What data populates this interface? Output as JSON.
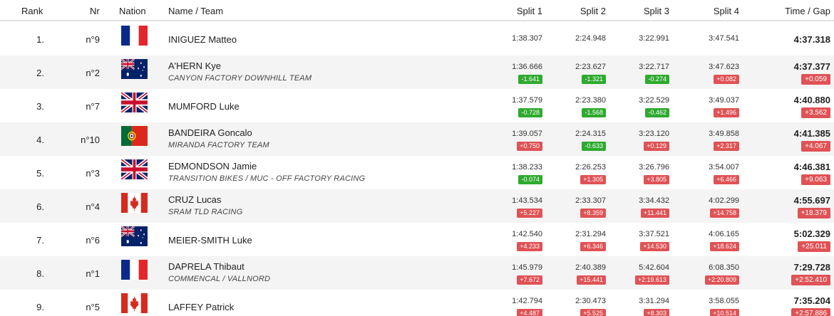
{
  "header": {
    "rank": "Rank",
    "nr": "Nr",
    "nation": "Nation",
    "name_team": "Name / Team",
    "split1": "Split 1",
    "split2": "Split 2",
    "split3": "Split 3",
    "split4": "Split 4",
    "time_gap": "Time / Gap"
  },
  "colors": {
    "positive_gap": "#e05255",
    "negative_gap": "#2eaa2e",
    "row_stripe": "#f4f4f4"
  },
  "rows": [
    {
      "rank": "1.",
      "nr": "n°9",
      "nation": "france-flag",
      "name": "INIGUEZ Matteo",
      "team": "",
      "splits": [
        {
          "time": "1:38.307",
          "diff": "",
          "sign": ""
        },
        {
          "time": "2:24.948",
          "diff": "",
          "sign": ""
        },
        {
          "time": "3:22.991",
          "diff": "",
          "sign": ""
        },
        {
          "time": "3:47.541",
          "diff": "",
          "sign": ""
        }
      ],
      "time": "4:37.318",
      "gap": ""
    },
    {
      "rank": "2.",
      "nr": "n°2",
      "nation": "australia-flag",
      "name": "A'HERN Kye",
      "team": "CANYON FACTORY DOWNHILL TEAM",
      "splits": [
        {
          "time": "1:36.666",
          "diff": "-1.641",
          "sign": "neg"
        },
        {
          "time": "2:23.627",
          "diff": "-1.321",
          "sign": "neg"
        },
        {
          "time": "3:22.717",
          "diff": "-0.274",
          "sign": "neg"
        },
        {
          "time": "3:47.623",
          "diff": "+0.082",
          "sign": "pos"
        }
      ],
      "time": "4:37.377",
      "gap": "+0.059"
    },
    {
      "rank": "3.",
      "nr": "n°7",
      "nation": "uk-flag",
      "name": "MUMFORD Luke",
      "team": "",
      "splits": [
        {
          "time": "1:37.579",
          "diff": "-0.728",
          "sign": "neg"
        },
        {
          "time": "2:23.380",
          "diff": "-1.568",
          "sign": "neg"
        },
        {
          "time": "3:22.529",
          "diff": "-0.462",
          "sign": "neg"
        },
        {
          "time": "3:49.037",
          "diff": "+1.496",
          "sign": "pos"
        }
      ],
      "time": "4:40.880",
      "gap": "+3.562"
    },
    {
      "rank": "4.",
      "nr": "n°10",
      "nation": "portugal-flag",
      "name": "BANDEIRA Goncalo",
      "team": "MIRANDA FACTORY TEAM",
      "splits": [
        {
          "time": "1:39.057",
          "diff": "+0.750",
          "sign": "pos"
        },
        {
          "time": "2:24.315",
          "diff": "-0.633",
          "sign": "neg"
        },
        {
          "time": "3:23.120",
          "diff": "+0.129",
          "sign": "pos"
        },
        {
          "time": "3:49.858",
          "diff": "+2.317",
          "sign": "pos"
        }
      ],
      "time": "4:41.385",
      "gap": "+4.067"
    },
    {
      "rank": "5.",
      "nr": "n°3",
      "nation": "uk-flag",
      "name": "EDMONDSON Jamie",
      "team": "TRANSITION BIKES / MUC - OFF FACTORY RACING",
      "splits": [
        {
          "time": "1:38.233",
          "diff": "-0.074",
          "sign": "neg"
        },
        {
          "time": "2:26.253",
          "diff": "+1.305",
          "sign": "pos"
        },
        {
          "time": "3:26.796",
          "diff": "+3.805",
          "sign": "pos"
        },
        {
          "time": "3:54.007",
          "diff": "+6.466",
          "sign": "pos"
        }
      ],
      "time": "4:46.381",
      "gap": "+9.063"
    },
    {
      "rank": "6.",
      "nr": "n°4",
      "nation": "canada-flag",
      "name": "CRUZ Lucas",
      "team": "SRAM TLD RACING",
      "splits": [
        {
          "time": "1:43.534",
          "diff": "+5.227",
          "sign": "pos"
        },
        {
          "time": "2:33.307",
          "diff": "+8.359",
          "sign": "pos"
        },
        {
          "time": "3:34.432",
          "diff": "+11.441",
          "sign": "pos"
        },
        {
          "time": "4:02.299",
          "diff": "+14.758",
          "sign": "pos"
        }
      ],
      "time": "4:55.697",
      "gap": "+18.379"
    },
    {
      "rank": "7.",
      "nr": "n°6",
      "nation": "australia-flag",
      "name": "MEIER-SMITH Luke",
      "team": "",
      "splits": [
        {
          "time": "1:42.540",
          "diff": "+4.233",
          "sign": "pos"
        },
        {
          "time": "2:31.294",
          "diff": "+6.346",
          "sign": "pos"
        },
        {
          "time": "3:37.521",
          "diff": "+14.530",
          "sign": "pos"
        },
        {
          "time": "4:06.165",
          "diff": "+18.624",
          "sign": "pos"
        }
      ],
      "time": "5:02.329",
      "gap": "+25.011"
    },
    {
      "rank": "8.",
      "nr": "n°1",
      "nation": "france-flag",
      "name": "DAPRELA Thibaut",
      "team": "COMMENCAL / VALLNORD",
      "splits": [
        {
          "time": "1:45.979",
          "diff": "+7.672",
          "sign": "pos"
        },
        {
          "time": "2:40.389",
          "diff": "+15.441",
          "sign": "pos"
        },
        {
          "time": "5:42.604",
          "diff": "+2:19.613",
          "sign": "pos"
        },
        {
          "time": "6:08.350",
          "diff": "+2:20.809",
          "sign": "pos"
        }
      ],
      "time": "7:29.728",
      "gap": "+2:52.410"
    },
    {
      "rank": "9.",
      "nr": "n°5",
      "nation": "canada-flag",
      "name": "LAFFEY Patrick",
      "team": "",
      "splits": [
        {
          "time": "1:42.794",
          "diff": "+4.487",
          "sign": "pos"
        },
        {
          "time": "2:30.473",
          "diff": "+5.525",
          "sign": "pos"
        },
        {
          "time": "3:31.294",
          "diff": "+8.303",
          "sign": "pos"
        },
        {
          "time": "3:58.055",
          "diff": "+10.514",
          "sign": "pos"
        }
      ],
      "time": "7:35.204",
      "gap": "+2:57.886"
    }
  ]
}
